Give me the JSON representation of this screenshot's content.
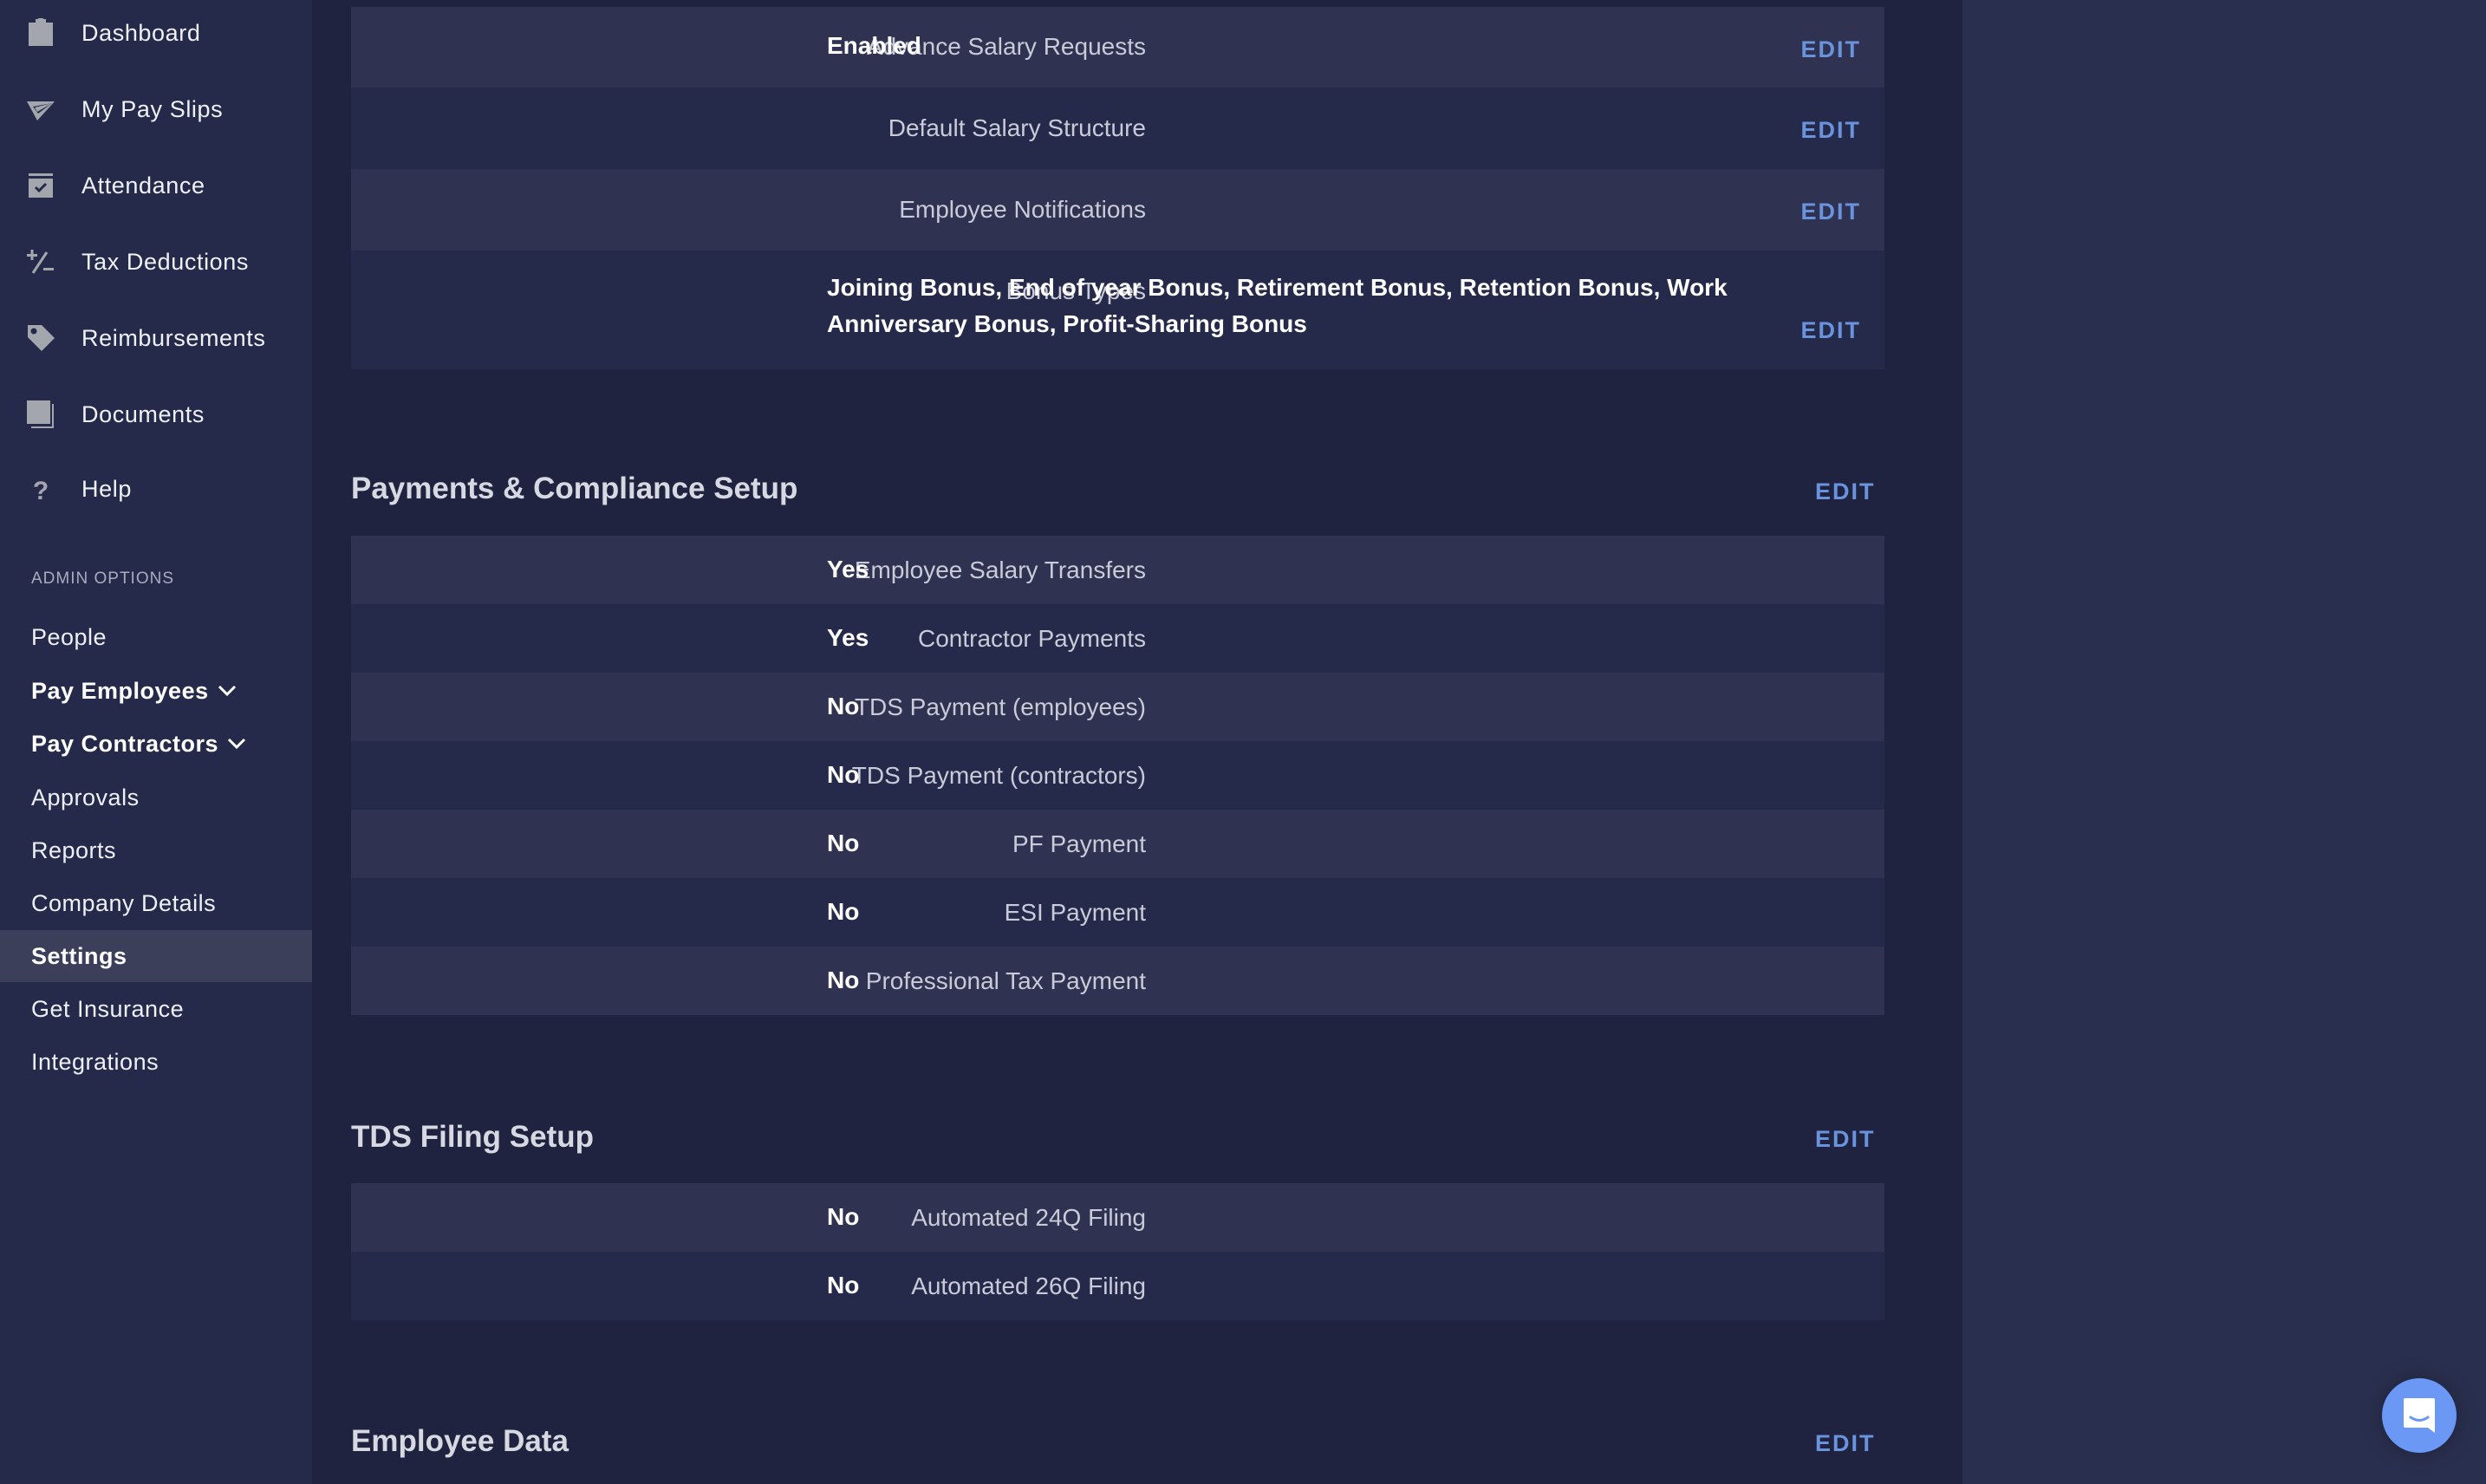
{
  "sidebar": {
    "nav_items": [
      {
        "label": "Dashboard",
        "icon": "clipboard-icon"
      },
      {
        "label": "My Pay Slips",
        "icon": "paper-plane-icon"
      },
      {
        "label": "Attendance",
        "icon": "calendar-check-icon"
      },
      {
        "label": "Tax Deductions",
        "icon": "plus-minus-icon"
      },
      {
        "label": "Reimbursements",
        "icon": "tag-icon"
      },
      {
        "label": "Documents",
        "icon": "documents-icon"
      },
      {
        "label": "Help",
        "icon": "question-icon"
      }
    ],
    "admin_header": "ADMIN OPTIONS",
    "admin_items": [
      {
        "label": "People"
      },
      {
        "label": "Pay Employees",
        "expandable": true
      },
      {
        "label": "Pay Contractors",
        "expandable": true
      },
      {
        "label": "Approvals"
      },
      {
        "label": "Reports"
      },
      {
        "label": "Company Details"
      },
      {
        "label": "Settings",
        "active": true
      },
      {
        "label": "Get Insurance"
      },
      {
        "label": "Integrations"
      }
    ]
  },
  "colors": {
    "accent": "#6a93dd",
    "chat_button": "#6b98f5",
    "sidebar_bg": "#252a4a",
    "main_bg": "#20233f",
    "row_odd": "#2f3250",
    "row_even": "#252a4a",
    "active_item": "#3b3f5a"
  },
  "edit_label": "EDIT",
  "salary_settings": {
    "rows": [
      {
        "label": "Advance Salary Requests",
        "value": "Enabled"
      },
      {
        "label": "Default Salary Structure",
        "value": ""
      },
      {
        "label": "Employee Notifications",
        "value": ""
      },
      {
        "label": "Bonus Types",
        "value": "Joining Bonus, End of year Bonus, Retirement Bonus, Retention Bonus, Work Anniversary Bonus, Profit-Sharing Bonus"
      }
    ]
  },
  "payments_compliance": {
    "title": "Payments & Compliance Setup",
    "rows": [
      {
        "label": "Employee Salary Transfers",
        "value": "Yes"
      },
      {
        "label": "Contractor Payments",
        "value": "Yes"
      },
      {
        "label": "TDS Payment (employees)",
        "value": "No"
      },
      {
        "label": "TDS Payment (contractors)",
        "value": "No"
      },
      {
        "label": "PF Payment",
        "value": "No"
      },
      {
        "label": "ESI Payment",
        "value": "No"
      },
      {
        "label": "Professional Tax Payment",
        "value": "No"
      }
    ]
  },
  "tds_filing": {
    "title": "TDS Filing Setup",
    "rows": [
      {
        "label": "Automated 24Q Filing",
        "value": "No"
      },
      {
        "label": "Automated 26Q Filing",
        "value": "No"
      }
    ]
  },
  "employee_data": {
    "title": "Employee Data"
  },
  "chat": {
    "icon": "chat-icon"
  }
}
